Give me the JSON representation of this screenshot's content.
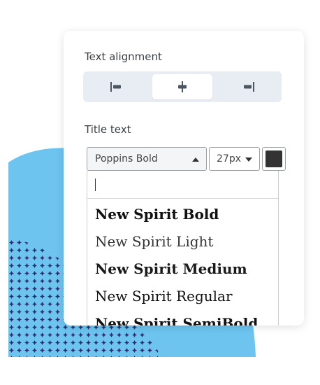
{
  "panel": {
    "alignment_label": "Text alignment",
    "alignment_options": [
      {
        "name": "align-left",
        "active": false
      },
      {
        "name": "align-center",
        "active": true
      },
      {
        "name": "align-right",
        "active": false
      }
    ],
    "title_label": "Title text",
    "font_select": {
      "value": "Poppins Bold"
    },
    "size_select": {
      "value": "27px"
    },
    "color_swatch": {
      "color": "#333333"
    },
    "search": {
      "value": ""
    },
    "font_options": [
      {
        "label": "New Spirit Bold",
        "weight": "bold"
      },
      {
        "label": "New Spirit Light",
        "weight": "light"
      },
      {
        "label": "New Spirit Medium",
        "weight": "medium"
      },
      {
        "label": "New Spirit Regular",
        "weight": "regular"
      },
      {
        "label": "New Spirit SemiBold",
        "weight": "semibold"
      }
    ]
  },
  "colors": {
    "blob": "#6cc4ef",
    "dots": "#2b2d6e",
    "panel_bg": "#ffffff",
    "segmented_bg": "#e8edf4"
  }
}
